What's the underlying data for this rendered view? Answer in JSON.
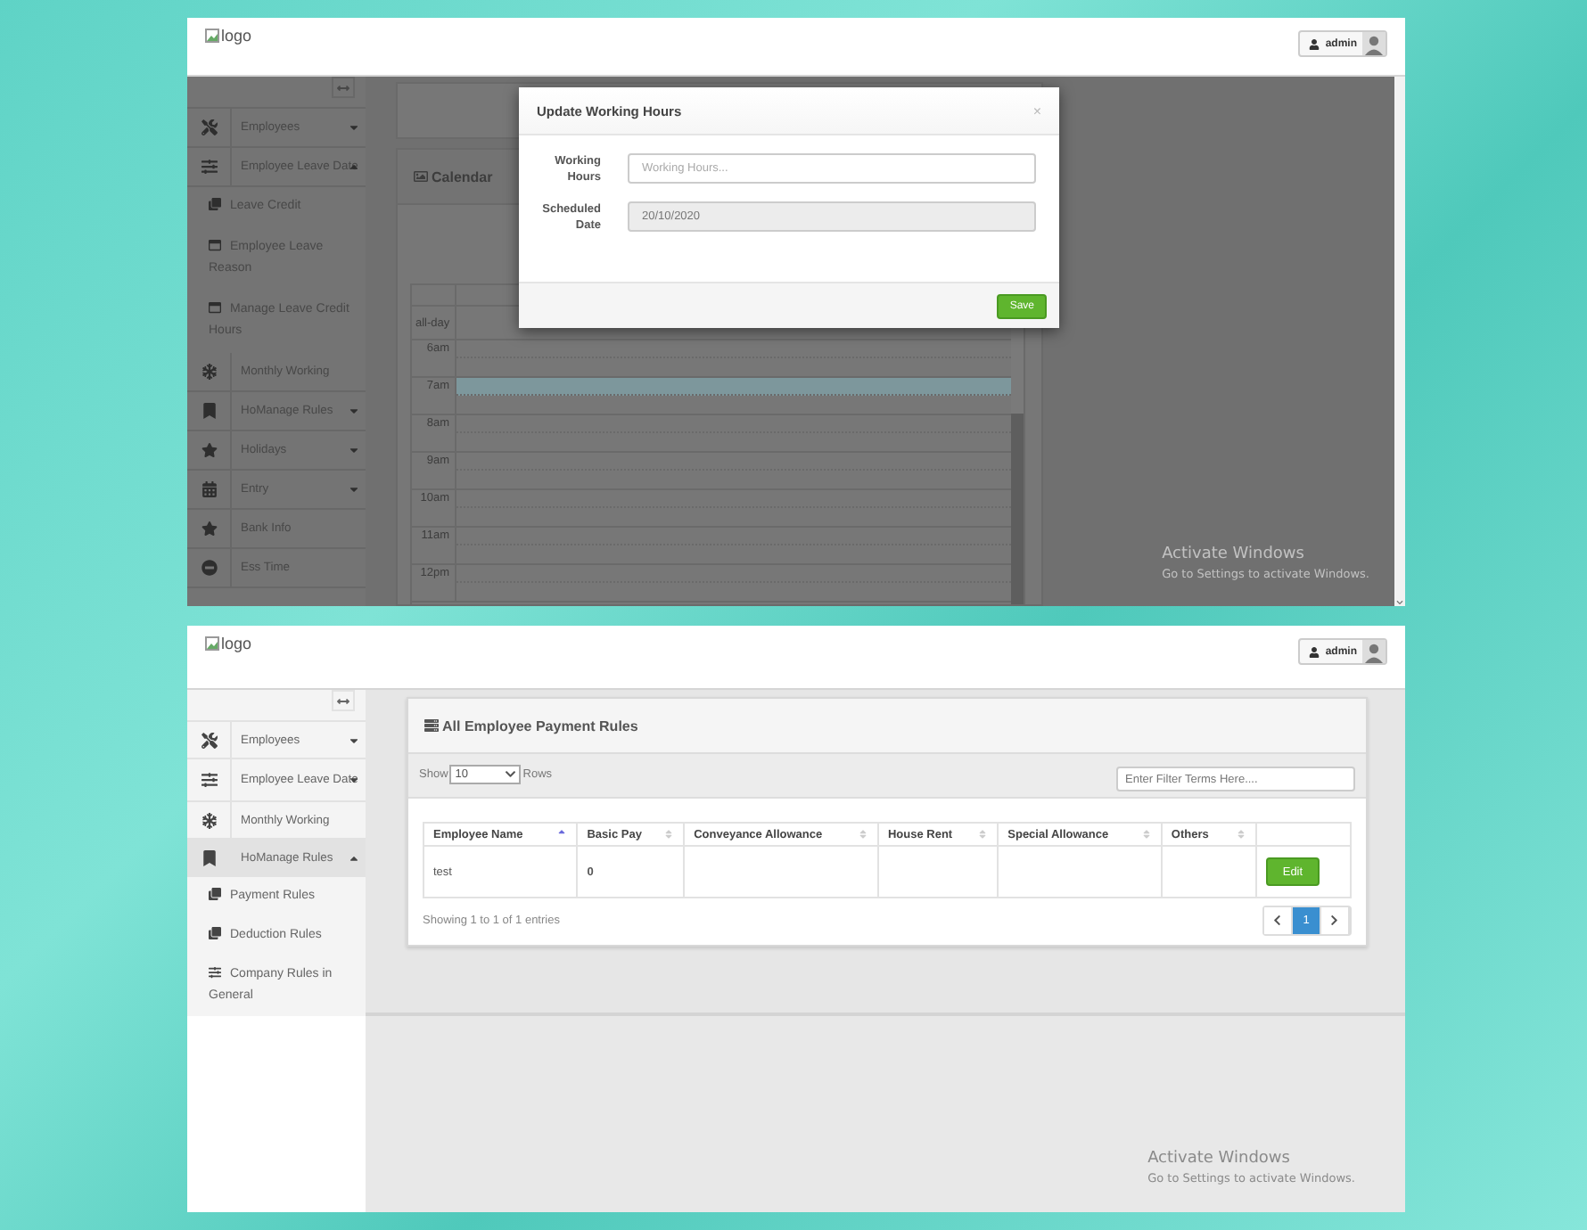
{
  "screens": [
    {
      "header": {
        "logo_alt": "logo",
        "user": "admin"
      },
      "sidebar": {
        "items": [
          {
            "label": "Employees",
            "expanded": false
          },
          {
            "label": "Employee Leave Date",
            "expanded": true,
            "children": [
              {
                "label": "Leave Credit"
              },
              {
                "label": "Employee Leave Reason"
              },
              {
                "label": "Manage Leave Credit Hours"
              }
            ]
          },
          {
            "label": "Monthly Working"
          },
          {
            "label": "Manage Rules",
            "prefix": "Ho",
            "expanded": false
          },
          {
            "label": "Holidays",
            "expanded": false
          },
          {
            "label": "Entry",
            "expanded": false
          },
          {
            "label": "Bank Info"
          },
          {
            "label": "Ess Time"
          }
        ]
      },
      "page": {
        "kind": "calendar",
        "title": "Calendar",
        "slots": [
          {
            "label": "all-day"
          },
          {
            "label": "6am",
            "highlighted": false
          },
          {
            "label": "7am",
            "highlighted": true
          },
          {
            "label": "8am",
            "highlighted": false
          },
          {
            "label": "9am",
            "highlighted": false
          },
          {
            "label": "10am",
            "highlighted": false
          },
          {
            "label": "11am",
            "highlighted": false
          },
          {
            "label": "12pm",
            "highlighted": false
          }
        ]
      },
      "modal": {
        "open": true,
        "title": "Update Working Hours",
        "close": "×",
        "fields": [
          {
            "label": "Working Hours",
            "placeholder": "Working Hours...",
            "disabled": false
          },
          {
            "label": "Scheduled Date",
            "value": "20/10/2020",
            "disabled": true
          }
        ],
        "button": "Save"
      },
      "os_notice": {
        "title": "Activate Windows",
        "text": "Go to Settings to activate Windows."
      }
    },
    {
      "header": {
        "logo_alt": "logo",
        "user": "admin"
      },
      "sidebar": {
        "items": [
          {
            "label": "Employees",
            "expanded": false
          },
          {
            "label": "Employee Leave Date",
            "expanded": false
          },
          {
            "label": "Monthly Working"
          },
          {
            "label": "Manage Rules",
            "prefix": "Ho",
            "expanded": true,
            "children": [
              {
                "label": "Payment Rules"
              },
              {
                "label": "Deduction Rules"
              },
              {
                "label": "Company Rules in General"
              }
            ]
          }
        ]
      },
      "page": {
        "kind": "table",
        "title": "All Employee Payment Rules",
        "show_label": "Show",
        "page_size": "10",
        "rows_label": "Rows",
        "filter_placeholder": "Enter Filter Terms Here....",
        "columns": [
          {
            "label": "Employee Name",
            "sortable": true,
            "sorted": true
          },
          {
            "label": "Basic Pay",
            "sortable": true,
            "sorted": false
          },
          {
            "label": "Conveyance Allowance",
            "sortable": true,
            "sorted": false
          },
          {
            "label": "House Rent",
            "sortable": true,
            "sorted": false
          },
          {
            "label": "Special Allowance",
            "sortable": true,
            "sorted": false
          },
          {
            "label": "Others",
            "sortable": true,
            "sorted": false
          },
          {
            "sortable": false
          }
        ],
        "rows": [
          {
            "cells": [
              "test",
              "0"
            ],
            "action": "Edit"
          }
        ],
        "info": "Showing 1 to 1 of 1 entries",
        "pages": [
          {
            "label": "1",
            "selected": true
          }
        ]
      },
      "modal": {
        "open": false
      },
      "os_notice": {
        "title": "Activate Windows",
        "text": "Go to Settings to activate Windows."
      }
    }
  ]
}
